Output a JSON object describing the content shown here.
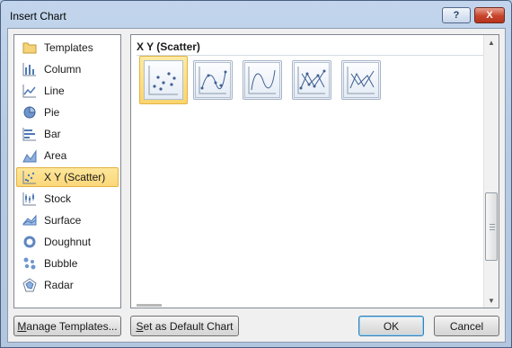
{
  "window": {
    "title": "Insert Chart",
    "help_label": "?",
    "close_label": "X"
  },
  "sidebar": {
    "items": [
      {
        "label": "Templates",
        "icon": "templates-folder-icon"
      },
      {
        "label": "Column",
        "icon": "column-chart-icon"
      },
      {
        "label": "Line",
        "icon": "line-chart-icon"
      },
      {
        "label": "Pie",
        "icon": "pie-chart-icon"
      },
      {
        "label": "Bar",
        "icon": "bar-chart-icon"
      },
      {
        "label": "Area",
        "icon": "area-chart-icon"
      },
      {
        "label": "X Y (Scatter)",
        "icon": "scatter-chart-icon",
        "selected": true
      },
      {
        "label": "Stock",
        "icon": "stock-chart-icon"
      },
      {
        "label": "Surface",
        "icon": "surface-chart-icon"
      },
      {
        "label": "Doughnut",
        "icon": "doughnut-chart-icon"
      },
      {
        "label": "Bubble",
        "icon": "bubble-chart-icon"
      },
      {
        "label": "Radar",
        "icon": "radar-chart-icon"
      }
    ]
  },
  "main": {
    "section_title": "X Y (Scatter)",
    "thumbnails": [
      {
        "icon": "scatter-markers-only-icon",
        "selected": true
      },
      {
        "icon": "scatter-smooth-lines-markers-icon"
      },
      {
        "icon": "scatter-smooth-lines-icon"
      },
      {
        "icon": "scatter-straight-lines-markers-icon"
      },
      {
        "icon": "scatter-straight-lines-icon"
      }
    ]
  },
  "buttons": {
    "manage_templates_mnemonic": "M",
    "manage_templates_rest": "anage Templates...",
    "set_default_mnemonic": "S",
    "set_default_rest": "et as Default Chart",
    "ok": "OK",
    "cancel": "Cancel"
  },
  "colors": {
    "selection_fill": "#fbd77a",
    "selection_border": "#e3b342",
    "title_bar": "#b9cde5",
    "close_button": "#c7442b"
  }
}
